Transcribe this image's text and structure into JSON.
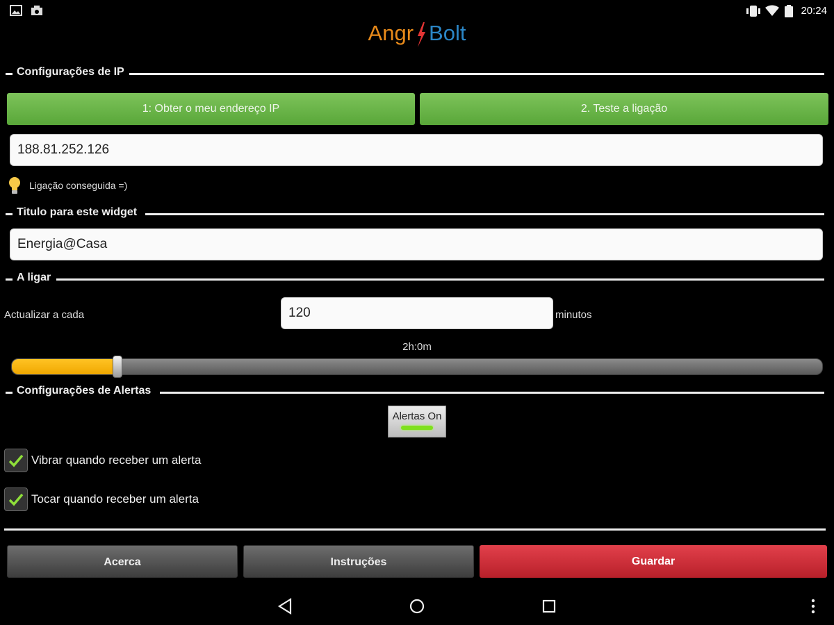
{
  "status_bar": {
    "time": "20:24",
    "icons": [
      "image-notification-icon",
      "download-notification-icon",
      "vibrate-icon",
      "wifi-icon",
      "battery-icon"
    ]
  },
  "logo": {
    "part1": "Angr",
    "part2": "Bolt"
  },
  "sections": {
    "ip": "Configurações de IP",
    "title": "Titulo para este widget",
    "power": "A ligar",
    "alerts": "Configurações de Alertas"
  },
  "ip": {
    "get_ip_button": "1: Obter o meu endereço IP",
    "test_button": "2. Teste a ligação",
    "address": "188.81.252.126",
    "status": "Ligação conseguida =)"
  },
  "widget": {
    "title_value": "Energia@Casa"
  },
  "update": {
    "label": "Actualizar a cada",
    "value": "120",
    "unit": "minutos",
    "slider_text": "2h:0m",
    "slider_fraction": 0.13
  },
  "alerts": {
    "toggle_label": "Alertas On",
    "toggle_on": true,
    "vibrate_label": "Vibrar quando receber um alerta",
    "vibrate_checked": true,
    "sound_label": "Tocar quando receber um alerta",
    "sound_checked": true
  },
  "buttons": {
    "about": "Acerca",
    "instructions": "Instruções",
    "save": "Guardar"
  },
  "colors": {
    "accent_green": "#6bb649",
    "slider_fill": "#f5b400",
    "save_red": "#d0303a",
    "logo_orange": "#e88a1a",
    "logo_blue": "#2b86c6"
  }
}
